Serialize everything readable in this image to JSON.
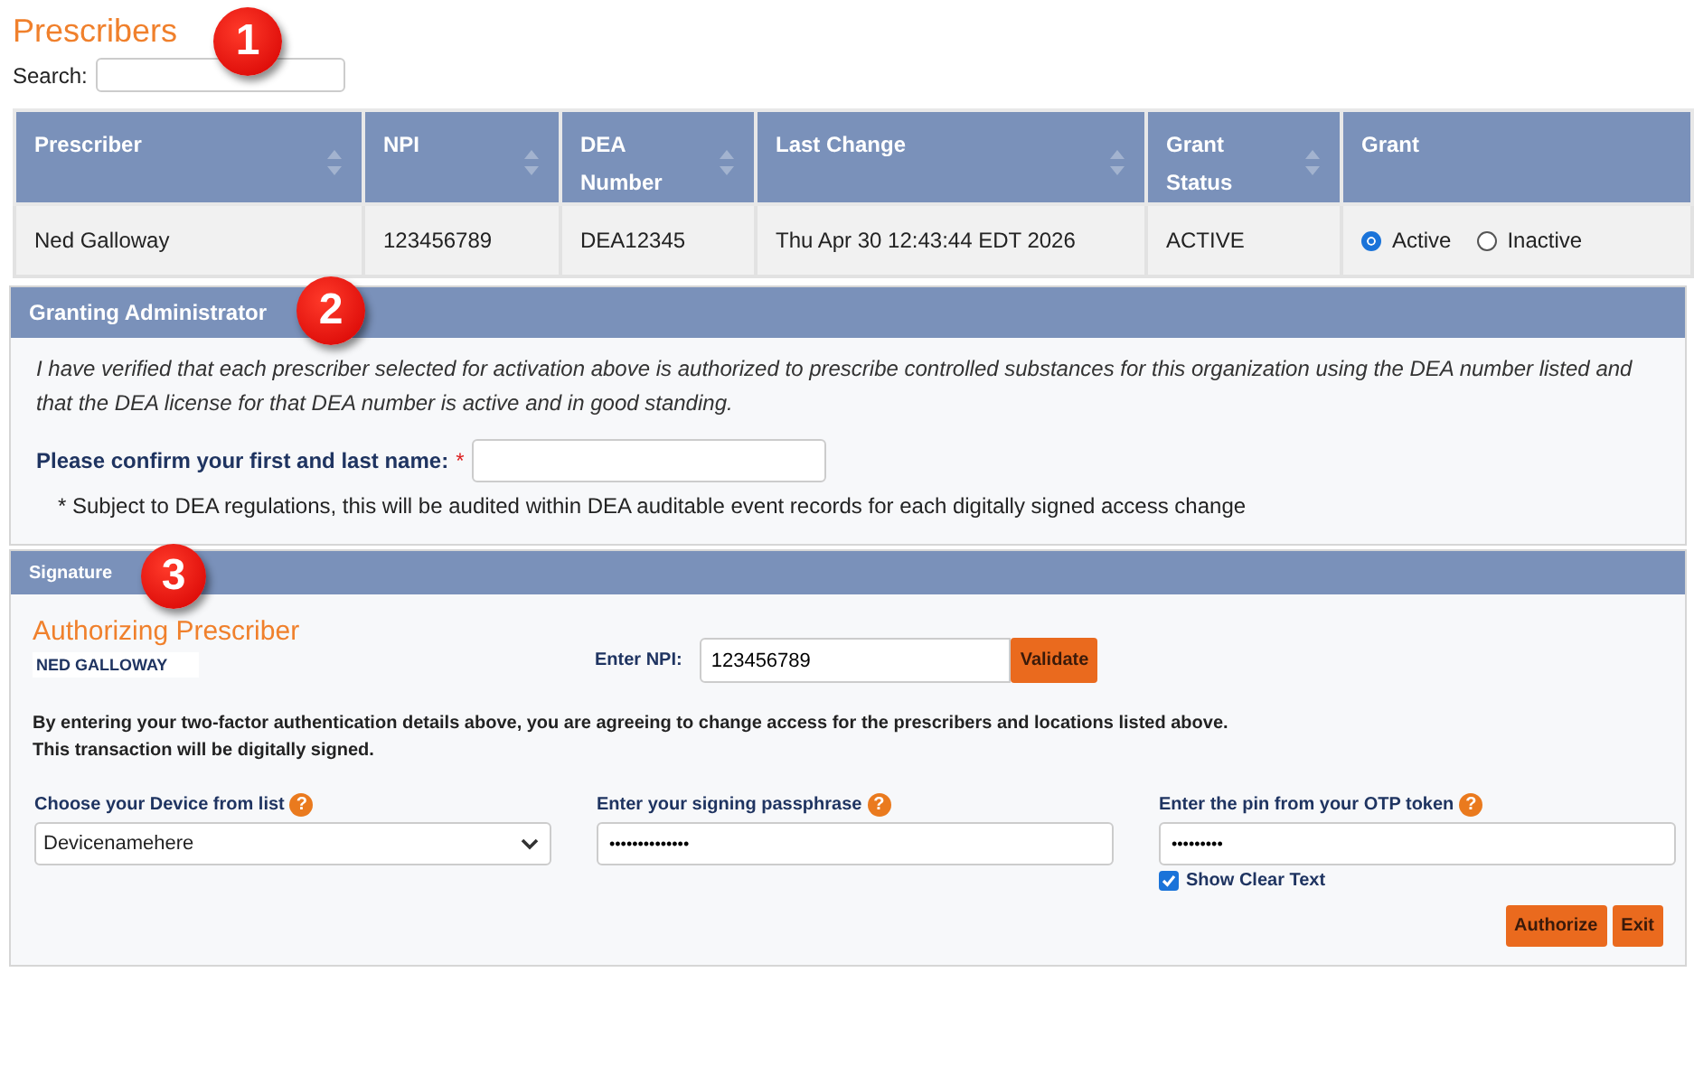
{
  "title": "Prescribers",
  "search": {
    "label": "Search:"
  },
  "table": {
    "columns": [
      {
        "label": "Prescriber",
        "sortable": true
      },
      {
        "label": "NPI",
        "sortable": true
      },
      {
        "label": "DEA Number",
        "sortable": true
      },
      {
        "label": "Last Change",
        "sortable": true
      },
      {
        "label": "Grant Status",
        "sortable": true
      },
      {
        "label": "Grant",
        "sortable": false
      }
    ],
    "rows": [
      {
        "prescriber": "Ned Galloway",
        "npi": "123456789",
        "dea": "DEA12345",
        "last_change": "Thu Apr 30 12:43:44 EDT 2026",
        "status": "ACTIVE",
        "grant": [
          {
            "label": "Active",
            "selected": true
          },
          {
            "label": "Inactive",
            "selected": false
          }
        ]
      }
    ]
  },
  "granting": {
    "title": "Granting Administrator",
    "statement": "I have verified that each prescriber selected for activation above is authorized to prescribe controlled substances for this organization using the DEA number listed and that the DEA license for that DEA number is active and in good standing.",
    "name_label": "Please confirm your first and last name:",
    "required_mark": "*",
    "note": "* Subject to DEA regulations, this will be audited within DEA auditable event records for each digitally signed access change"
  },
  "signature": {
    "title": "Signature",
    "heading": "Authorizing Prescriber",
    "prescriber_name": "NED GALLOWAY",
    "npi_label": "Enter NPI:",
    "npi_value": "123456789",
    "validate": "Validate",
    "agreement": [
      "By entering your two-factor authentication details above, you are agreeing to change access for the prescribers and locations listed above.",
      "This transaction will be digitally signed."
    ],
    "device_label": "Choose your Device from list",
    "device_value": "Devicenamehere",
    "help_mark": "?",
    "passphrase_label": "Enter your signing passphrase",
    "passphrase_value": "••••••••••••••",
    "pin_label": "Enter the pin from your OTP token",
    "pin_value": "•••••••••",
    "show_clear": {
      "label": "Show Clear Text",
      "checked": true
    },
    "buttons": [
      "Authorize",
      "Exit"
    ]
  },
  "callouts": [
    "1",
    "2",
    "3"
  ]
}
